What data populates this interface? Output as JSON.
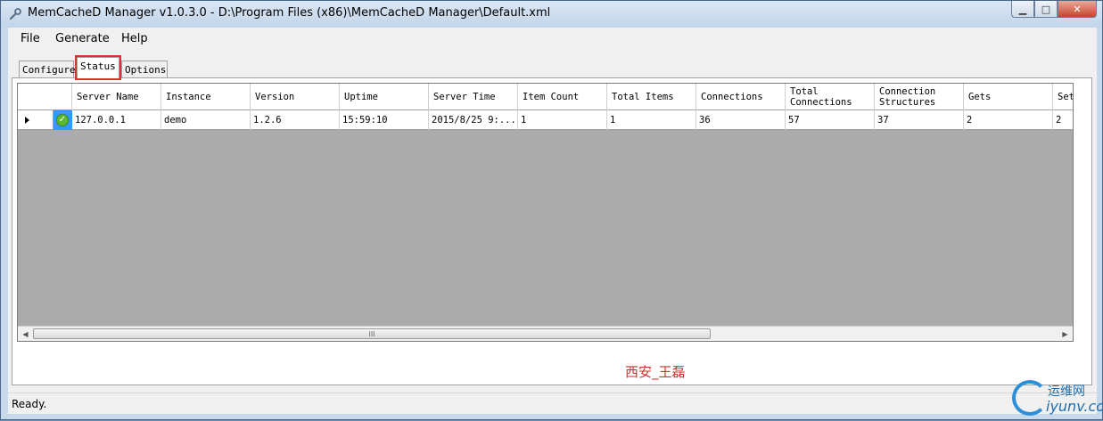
{
  "window": {
    "title": "MemCacheD Manager v1.0.3.0 - D:\\Program Files (x86)\\MemCacheD Manager\\Default.xml",
    "icon": "wrench-icon",
    "minimize_label": "▁",
    "maximize_label": "□",
    "close_label": "✕"
  },
  "menu": {
    "file": "File",
    "generate": "Generate",
    "help": "Help"
  },
  "tabs": [
    {
      "label": "Configure",
      "active": false
    },
    {
      "label": "Status",
      "active": true
    },
    {
      "label": "Options",
      "active": false
    }
  ],
  "grid": {
    "columns": [
      "Server Name",
      "Instance",
      "Version",
      "Uptime",
      "Server Time",
      "Item Count",
      "Total Items",
      "Connections",
      "Total Connections",
      "Connection Structures",
      "Gets",
      "Set"
    ],
    "columns_display": {
      "total_connections_1": "Total",
      "total_connections_2": "Connections",
      "connection_structures_1": "Connection",
      "connection_structures_2": "Structures"
    },
    "rows": [
      {
        "status": "ok",
        "server_name": "127.0.0.1",
        "instance": "demo",
        "version": "1.2.6",
        "uptime": "15:59:10",
        "server_time": "2015/8/25 9:...",
        "item_count": "1",
        "total_items": "1",
        "connections": "36",
        "total_connections": "57",
        "connection_structures": "37",
        "gets": "2",
        "set": "2"
      }
    ],
    "scroll_thumb_grip": "III"
  },
  "watermark": "西安_王磊",
  "status_bar": {
    "text": "Ready."
  },
  "site_logo": {
    "top": "运维网",
    "bottom": "iyunv.com"
  },
  "colors": {
    "selection_highlight": "#e03030",
    "grid_background": "#ababab",
    "row_status_cell": "#3399ff",
    "ok_icon": "#5cb82e"
  }
}
